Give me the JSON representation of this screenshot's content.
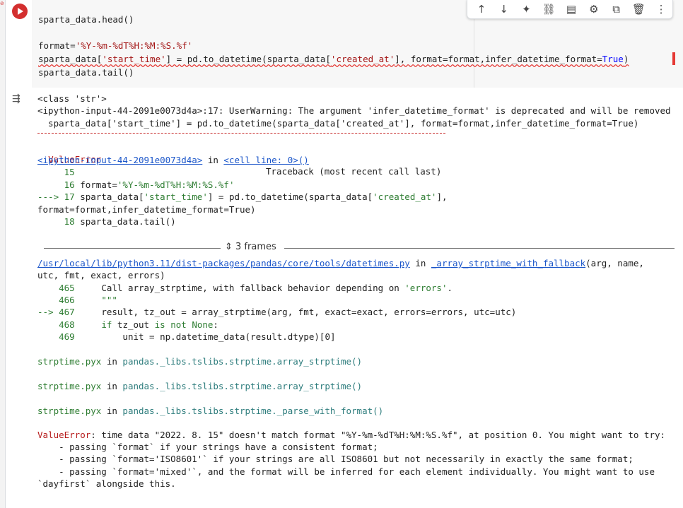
{
  "cell": {
    "lines": [
      "sparta_data.head()",
      "format='%Y-%m-%dT%H:%M:%S.%f'",
      "sparta_data['start_time'] = pd.to_datetime(sparta_data['created_at'], format=format,infer_datetime_format=True)",
      "sparta_data.tail()"
    ]
  },
  "toolbar": {
    "icons": [
      "arrow-up-icon",
      "arrow-down-icon",
      "sparkle-icon",
      "link-icon",
      "comment-icon",
      "gear-icon",
      "open-external-icon",
      "trash-icon",
      "more-vert-icon"
    ],
    "glyphs": [
      "↑",
      "↓",
      "✦",
      "⛓",
      "▤",
      "⚙",
      "⧉",
      "🗑",
      "⋮"
    ]
  },
  "output": {
    "class_str": "<class 'str'>",
    "warning_prefix": "<ipython-input-44-2091e0073d4a>:17: UserWarning: The argument 'infer_datetime_format' is deprecated and will be removed",
    "warning_code": "  sparta_data['start_time'] = pd.to_datetime(sparta_data['created_at'], format=format,infer_datetime_format=True)",
    "error_name": "ValueError",
    "traceback_label": "Traceback (most recent call last)",
    "tb_link": "<ipython-input-44-2091e0073d4a>",
    "tb_in": " in ",
    "tb_cell": "<cell line: 0>()",
    "l15": "     15",
    "l16_num": "     16",
    "l16_code": " format='%Y-%m-%dT%H:%M:%S.%f'",
    "l17_num": "---> 17",
    "l17_code": " sparta_data['start_time'] = pd.to_datetime(sparta_data['created_at'],",
    "l17_cont": "format=format,infer_datetime_format=True)",
    "l18_num": "     18",
    "l18_code": " sparta_data.tail()",
    "frames_label": "3 frames",
    "path_link": "/usr/local/lib/python3.11/dist-packages/pandas/core/tools/datetimes.py",
    "path_in": " in ",
    "path_fn": "_array_strptime_with_fallback",
    "path_args1": "(arg, name,",
    "path_args2": "utc, fmt, exact, errors)",
    "f465_num": "    465",
    "f465_code": "     Call array_strptime, with fallback behavior depending on 'errors'.",
    "f466_num": "    466",
    "f466_code": "     \"\"\"",
    "f467_num": "--> 467",
    "f467_code": "     result, tz_out = array_strptime(arg, fmt, exact=exact, errors=errors, utc=utc)",
    "f468_num": "    468",
    "f468_code": "     if tz_out is not None:",
    "f469_num": "    469",
    "f469_code": "         unit = np.datetime_data(result.dtype)[0]",
    "pyx": [
      {
        "file": "strptime.pyx",
        "in": " in ",
        "fn": "pandas._libs.tslibs.strptime.array_strptime()"
      },
      {
        "file": "strptime.pyx",
        "in": " in ",
        "fn": "pandas._libs.tslibs.strptime.array_strptime()"
      },
      {
        "file": "strptime.pyx",
        "in": " in ",
        "fn": "pandas._libs.tslibs.strptime._parse_with_format()"
      }
    ],
    "final_error_name": "ValueError",
    "final_error_msg": ": time data \"2022. 8. 15\" doesn't match format \"%Y-%m-%dT%H:%M:%S.%f\", at position 0. You might want to try:",
    "hint1": "    - passing `format` if your strings have a consistent format;",
    "hint2": "    - passing `format='ISO8601'` if your strings are all ISO8601 but not necessarily in exactly the same format;",
    "hint3": "    - passing `format='mixed'`, and the format will be inferred for each element individually. You might want to use",
    "hint4": "`dayfirst` alongside this."
  }
}
